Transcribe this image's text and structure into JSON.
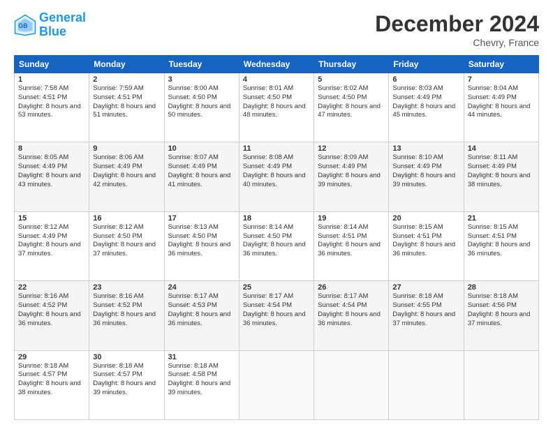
{
  "header": {
    "logo_line1": "General",
    "logo_line2": "Blue",
    "title": "December 2024",
    "location": "Chevry, France"
  },
  "columns": [
    "Sunday",
    "Monday",
    "Tuesday",
    "Wednesday",
    "Thursday",
    "Friday",
    "Saturday"
  ],
  "weeks": [
    [
      {
        "day": "1",
        "sunrise": "7:58 AM",
        "sunset": "4:51 PM",
        "daylight": "8 hours and 53 minutes."
      },
      {
        "day": "2",
        "sunrise": "7:59 AM",
        "sunset": "4:51 PM",
        "daylight": "8 hours and 51 minutes."
      },
      {
        "day": "3",
        "sunrise": "8:00 AM",
        "sunset": "4:50 PM",
        "daylight": "8 hours and 50 minutes."
      },
      {
        "day": "4",
        "sunrise": "8:01 AM",
        "sunset": "4:50 PM",
        "daylight": "8 hours and 48 minutes."
      },
      {
        "day": "5",
        "sunrise": "8:02 AM",
        "sunset": "4:50 PM",
        "daylight": "8 hours and 47 minutes."
      },
      {
        "day": "6",
        "sunrise": "8:03 AM",
        "sunset": "4:49 PM",
        "daylight": "8 hours and 45 minutes."
      },
      {
        "day": "7",
        "sunrise": "8:04 AM",
        "sunset": "4:49 PM",
        "daylight": "8 hours and 44 minutes."
      }
    ],
    [
      {
        "day": "8",
        "sunrise": "8:05 AM",
        "sunset": "4:49 PM",
        "daylight": "8 hours and 43 minutes."
      },
      {
        "day": "9",
        "sunrise": "8:06 AM",
        "sunset": "4:49 PM",
        "daylight": "8 hours and 42 minutes."
      },
      {
        "day": "10",
        "sunrise": "8:07 AM",
        "sunset": "4:49 PM",
        "daylight": "8 hours and 41 minutes."
      },
      {
        "day": "11",
        "sunrise": "8:08 AM",
        "sunset": "4:49 PM",
        "daylight": "8 hours and 40 minutes."
      },
      {
        "day": "12",
        "sunrise": "8:09 AM",
        "sunset": "4:49 PM",
        "daylight": "8 hours and 39 minutes."
      },
      {
        "day": "13",
        "sunrise": "8:10 AM",
        "sunset": "4:49 PM",
        "daylight": "8 hours and 39 minutes."
      },
      {
        "day": "14",
        "sunrise": "8:11 AM",
        "sunset": "4:49 PM",
        "daylight": "8 hours and 38 minutes."
      }
    ],
    [
      {
        "day": "15",
        "sunrise": "8:12 AM",
        "sunset": "4:49 PM",
        "daylight": "8 hours and 37 minutes."
      },
      {
        "day": "16",
        "sunrise": "8:12 AM",
        "sunset": "4:50 PM",
        "daylight": "8 hours and 37 minutes."
      },
      {
        "day": "17",
        "sunrise": "8:13 AM",
        "sunset": "4:50 PM",
        "daylight": "8 hours and 36 minutes."
      },
      {
        "day": "18",
        "sunrise": "8:14 AM",
        "sunset": "4:50 PM",
        "daylight": "8 hours and 36 minutes."
      },
      {
        "day": "19",
        "sunrise": "8:14 AM",
        "sunset": "4:51 PM",
        "daylight": "8 hours and 36 minutes."
      },
      {
        "day": "20",
        "sunrise": "8:15 AM",
        "sunset": "4:51 PM",
        "daylight": "8 hours and 36 minutes."
      },
      {
        "day": "21",
        "sunrise": "8:15 AM",
        "sunset": "4:51 PM",
        "daylight": "8 hours and 36 minutes."
      }
    ],
    [
      {
        "day": "22",
        "sunrise": "8:16 AM",
        "sunset": "4:52 PM",
        "daylight": "8 hours and 36 minutes."
      },
      {
        "day": "23",
        "sunrise": "8:16 AM",
        "sunset": "4:52 PM",
        "daylight": "8 hours and 36 minutes."
      },
      {
        "day": "24",
        "sunrise": "8:17 AM",
        "sunset": "4:53 PM",
        "daylight": "8 hours and 36 minutes."
      },
      {
        "day": "25",
        "sunrise": "8:17 AM",
        "sunset": "4:54 PM",
        "daylight": "8 hours and 36 minutes."
      },
      {
        "day": "26",
        "sunrise": "8:17 AM",
        "sunset": "4:54 PM",
        "daylight": "8 hours and 36 minutes."
      },
      {
        "day": "27",
        "sunrise": "8:18 AM",
        "sunset": "4:55 PM",
        "daylight": "8 hours and 37 minutes."
      },
      {
        "day": "28",
        "sunrise": "8:18 AM",
        "sunset": "4:56 PM",
        "daylight": "8 hours and 37 minutes."
      }
    ],
    [
      {
        "day": "29",
        "sunrise": "8:18 AM",
        "sunset": "4:57 PM",
        "daylight": "8 hours and 38 minutes."
      },
      {
        "day": "30",
        "sunrise": "8:18 AM",
        "sunset": "4:57 PM",
        "daylight": "8 hours and 39 minutes."
      },
      {
        "day": "31",
        "sunrise": "8:18 AM",
        "sunset": "4:58 PM",
        "daylight": "8 hours and 39 minutes."
      },
      null,
      null,
      null,
      null
    ]
  ]
}
